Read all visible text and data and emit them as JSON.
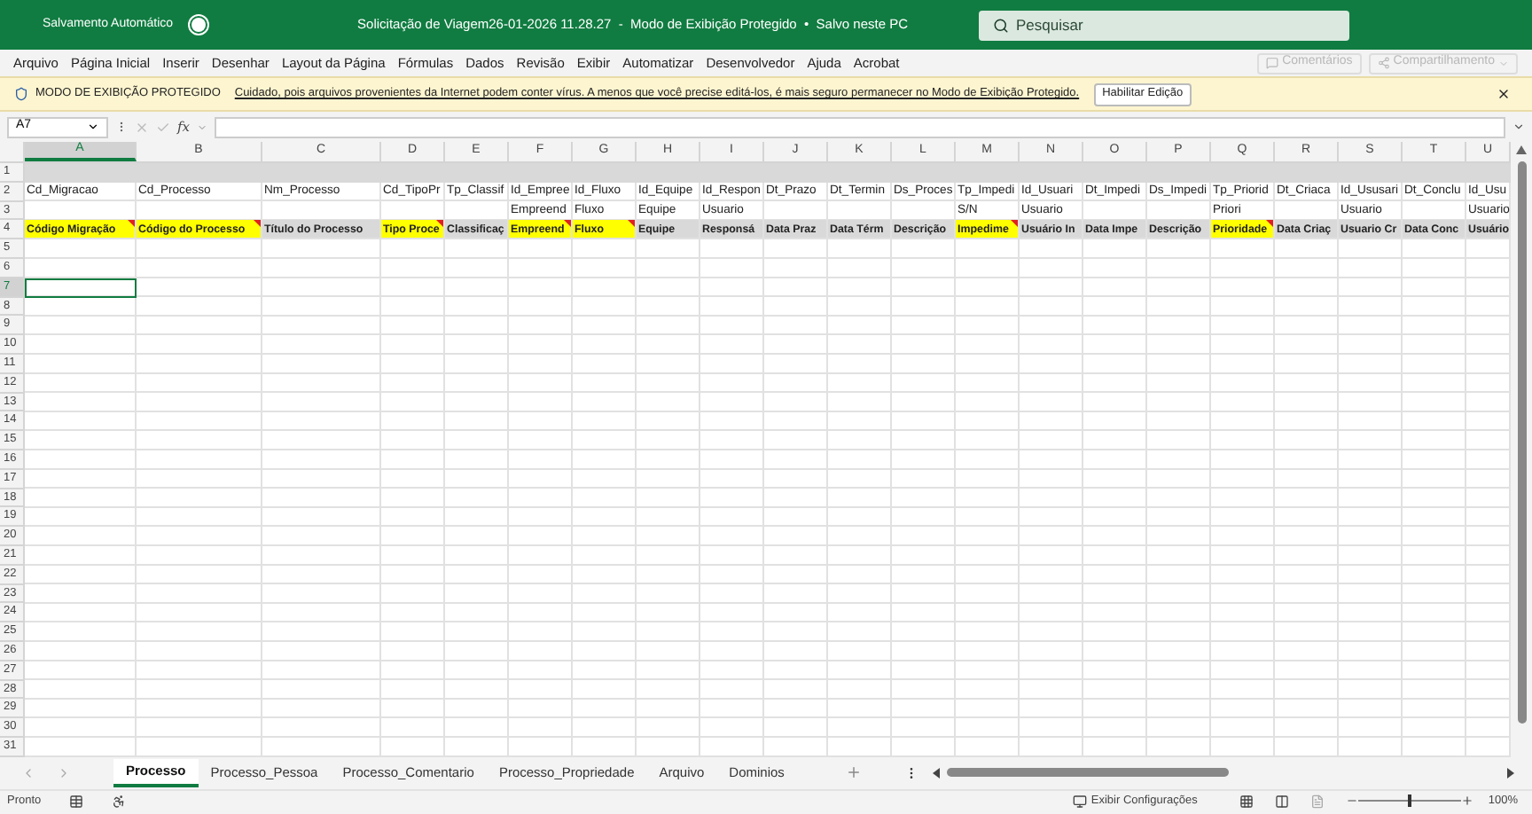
{
  "title_bar": {
    "autosave_label": "Salvamento Automático",
    "autosave_on": false,
    "document_title": "Solicitação de Viagem26-01-2026 11.28.27  -  Modo de Exibição Protegido  •  Salvo neste PC",
    "search": {
      "placeholder": "Pesquisar"
    }
  },
  "ribbon_tabs": [
    "Arquivo",
    "Página Inicial",
    "Inserir",
    "Desenhar",
    "Layout da Página",
    "Fórmulas",
    "Dados",
    "Revisão",
    "Exibir",
    "Automatizar",
    "Desenvolvedor",
    "Ajuda",
    "Acrobat"
  ],
  "ribbon_buttons": [
    {
      "label": "Comentários",
      "disabled": true
    },
    {
      "label": "Compartilhamento",
      "disabled": true
    }
  ],
  "protected_banner": {
    "title": "MODO DE EXIBIÇÃO PROTEGIDO",
    "message": "Cuidado, pois arquivos provenientes da Internet podem conter vírus. A menos que você precise editá-los, é mais seguro permanecer no Modo de  Exibição Protegido.",
    "button": "Habilitar Edição"
  },
  "formula_bar": {
    "name_box": "A7",
    "formula_icon": "fx"
  },
  "columns": [
    {
      "label": "A",
      "selected": true
    },
    {
      "label": "B",
      "selected": false
    },
    {
      "label": "C",
      "selected": false
    },
    {
      "label": "D",
      "selected": false
    },
    {
      "label": "E",
      "selected": false
    },
    {
      "label": "F",
      "selected": false
    },
    {
      "label": "G",
      "selected": false
    },
    {
      "label": "H",
      "selected": false
    },
    {
      "label": "I",
      "selected": false
    },
    {
      "label": "J",
      "selected": false
    },
    {
      "label": "K",
      "selected": false
    },
    {
      "label": "L",
      "selected": false
    },
    {
      "label": "M",
      "selected": false
    },
    {
      "label": "N",
      "selected": false
    },
    {
      "label": "O",
      "selected": false
    },
    {
      "label": "P",
      "selected": false
    },
    {
      "label": "Q",
      "selected": false
    },
    {
      "label": "R",
      "selected": false
    },
    {
      "label": "S",
      "selected": false
    },
    {
      "label": "T",
      "selected": false
    },
    {
      "label": "U",
      "selected": false
    }
  ],
  "rows": [
    {
      "number": "1",
      "selected": false,
      "shaded": true,
      "cells": []
    },
    {
      "number": "2",
      "selected": false,
      "shaded": false,
      "cells": [
        {
          "text": "Cd_Migracao"
        },
        {
          "text": "Cd_Processo"
        },
        {
          "text": "Nm_Processo"
        },
        {
          "text": "Cd_TipoPr"
        },
        {
          "text": "Tp_Classif"
        },
        {
          "text": "Id_Empree"
        },
        {
          "text": "Id_Fluxo"
        },
        {
          "text": "Id_Equipe"
        },
        {
          "text": "Id_Respon"
        },
        {
          "text": "Dt_Prazo"
        },
        {
          "text": "Dt_Termin"
        },
        {
          "text": "Ds_Proces"
        },
        {
          "text": "Tp_Impedi"
        },
        {
          "text": "Id_Usuari"
        },
        {
          "text": "Dt_Impedi"
        },
        {
          "text": "Ds_Impedi"
        },
        {
          "text": "Tp_Priorid"
        },
        {
          "text": "Dt_Criaca"
        },
        {
          "text": "Id_Ususari"
        },
        {
          "text": "Dt_Conclu"
        },
        {
          "text": "Id_Usu"
        }
      ]
    },
    {
      "number": "3",
      "selected": false,
      "shaded": false,
      "cells": [
        {
          "text": ""
        },
        {
          "text": ""
        },
        {
          "text": ""
        },
        {
          "text": ""
        },
        {
          "text": ""
        },
        {
          "text": "Empreend"
        },
        {
          "text": "Fluxo"
        },
        {
          "text": "Equipe"
        },
        {
          "text": "Usuario"
        },
        {
          "text": ""
        },
        {
          "text": ""
        },
        {
          "text": ""
        },
        {
          "text": "S/N"
        },
        {
          "text": "Usuario"
        },
        {
          "text": ""
        },
        {
          "text": ""
        },
        {
          "text": "Priori"
        },
        {
          "text": ""
        },
        {
          "text": "Usuario"
        },
        {
          "text": ""
        },
        {
          "text": "Usuario"
        }
      ]
    },
    {
      "number": "4",
      "selected": false,
      "shaded": false,
      "cells": [
        {
          "text": "Código Migração",
          "highlight": true,
          "comment": true
        },
        {
          "text": "Código do Processo",
          "highlight": true,
          "comment": true
        },
        {
          "text": "Título do Processo",
          "highlight": false,
          "comment": false
        },
        {
          "text": "Tipo Proce",
          "highlight": true,
          "comment": true
        },
        {
          "text": "Classificaç",
          "highlight": false,
          "comment": false
        },
        {
          "text": "Empreend",
          "highlight": true,
          "comment": true
        },
        {
          "text": "Fluxo",
          "highlight": true,
          "comment": true
        },
        {
          "text": "Equipe",
          "highlight": false,
          "comment": false
        },
        {
          "text": "Responsá",
          "highlight": false,
          "comment": false
        },
        {
          "text": "Data Praz",
          "highlight": false,
          "comment": false
        },
        {
          "text": "Data Térm",
          "highlight": false,
          "comment": false
        },
        {
          "text": "Descrição",
          "highlight": false,
          "comment": false
        },
        {
          "text": "Impedime",
          "highlight": true,
          "comment": true
        },
        {
          "text": "Usuário In",
          "highlight": false,
          "comment": false
        },
        {
          "text": "Data Impe",
          "highlight": false,
          "comment": false
        },
        {
          "text": "Descrição",
          "highlight": false,
          "comment": false
        },
        {
          "text": "Prioridade",
          "highlight": true,
          "comment": true
        },
        {
          "text": "Data Criaç",
          "highlight": false,
          "comment": false
        },
        {
          "text": "Usuario Cr",
          "highlight": false,
          "comment": false
        },
        {
          "text": "Data Conc",
          "highlight": false,
          "comment": false
        },
        {
          "text": "Usuário",
          "highlight": false,
          "comment": false
        }
      ]
    },
    {
      "number": "5",
      "selected": false,
      "shaded": false,
      "cells": []
    },
    {
      "number": "6",
      "selected": false,
      "shaded": false,
      "cells": []
    },
    {
      "number": "7",
      "selected": true,
      "shaded": false,
      "cells": []
    },
    {
      "number": "8",
      "selected": false,
      "shaded": false,
      "cells": []
    },
    {
      "number": "9",
      "selected": false,
      "shaded": false,
      "cells": []
    },
    {
      "number": "10",
      "selected": false,
      "shaded": false,
      "cells": []
    },
    {
      "number": "11",
      "selected": false,
      "shaded": false,
      "cells": []
    },
    {
      "number": "12",
      "selected": false,
      "shaded": false,
      "cells": []
    },
    {
      "number": "13",
      "selected": false,
      "shaded": false,
      "cells": []
    },
    {
      "number": "14",
      "selected": false,
      "shaded": false,
      "cells": []
    },
    {
      "number": "15",
      "selected": false,
      "shaded": false,
      "cells": []
    },
    {
      "number": "16",
      "selected": false,
      "shaded": false,
      "cells": []
    },
    {
      "number": "17",
      "selected": false,
      "shaded": false,
      "cells": []
    },
    {
      "number": "18",
      "selected": false,
      "shaded": false,
      "cells": []
    },
    {
      "number": "19",
      "selected": false,
      "shaded": false,
      "cells": []
    },
    {
      "number": "20",
      "selected": false,
      "shaded": false,
      "cells": []
    },
    {
      "number": "21",
      "selected": false,
      "shaded": false,
      "cells": []
    },
    {
      "number": "22",
      "selected": false,
      "shaded": false,
      "cells": []
    },
    {
      "number": "23",
      "selected": false,
      "shaded": false,
      "cells": []
    },
    {
      "number": "24",
      "selected": false,
      "shaded": false,
      "cells": []
    },
    {
      "number": "25",
      "selected": false,
      "shaded": false,
      "cells": []
    },
    {
      "number": "26",
      "selected": false,
      "shaded": false,
      "cells": []
    },
    {
      "number": "27",
      "selected": false,
      "shaded": false,
      "cells": []
    },
    {
      "number": "28",
      "selected": false,
      "shaded": false,
      "cells": []
    },
    {
      "number": "29",
      "selected": false,
      "shaded": false,
      "cells": []
    },
    {
      "number": "30",
      "selected": false,
      "shaded": false,
      "cells": []
    },
    {
      "number": "31",
      "selected": false,
      "shaded": false,
      "cells": []
    }
  ],
  "sheet_tabs": [
    {
      "label": "Processo",
      "selected": true
    },
    {
      "label": "Processo_Pessoa",
      "selected": false
    },
    {
      "label": "Processo_Comentario",
      "selected": false
    },
    {
      "label": "Processo_Propriedade",
      "selected": false
    },
    {
      "label": "Arquivo",
      "selected": false
    },
    {
      "label": "Dominios",
      "selected": false
    }
  ],
  "status_bar": {
    "status": "Pronto",
    "display_settings": "Exibir Configurações",
    "zoom": "100%",
    "zoom_slider": {
      "level": 0.5
    }
  }
}
